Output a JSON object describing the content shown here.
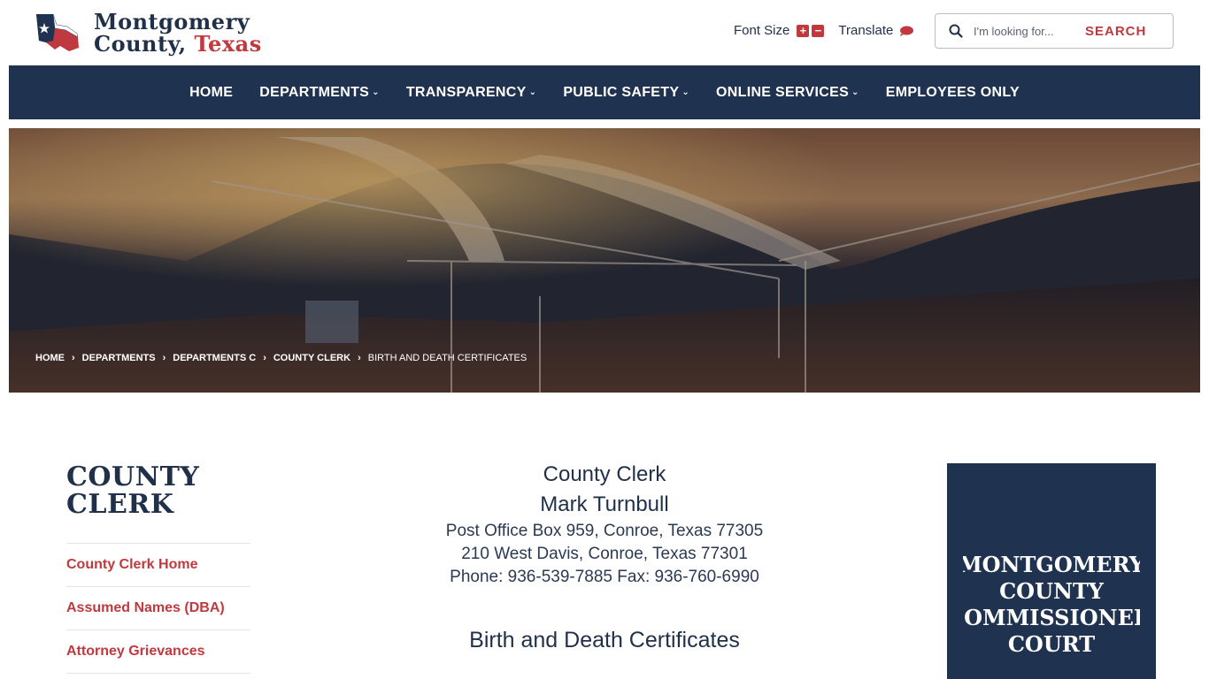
{
  "logo": {
    "line1": "Montgomery",
    "line2_prefix": "County, ",
    "line2_accent": "Texas"
  },
  "utility": {
    "font_size_label": "Font Size",
    "font_plus": "+",
    "font_minus": "−",
    "translate_label": "Translate"
  },
  "search": {
    "placeholder": "I'm looking for...",
    "button_label": "SEARCH"
  },
  "nav": {
    "items": [
      {
        "label": "HOME"
      },
      {
        "label": "DEPARTMENTS"
      },
      {
        "label": "TRANSPARENCY"
      },
      {
        "label": "PUBLIC SAFETY"
      },
      {
        "label": "ONLINE SERVICES"
      },
      {
        "label": "EMPLOYEES ONLY"
      }
    ],
    "chevron": "⌄"
  },
  "breadcrumb": {
    "items": [
      "HOME",
      "DEPARTMENTS",
      "DEPARTMENTS C",
      "COUNTY CLERK",
      "BIRTH AND DEATH CERTIFICATES"
    ],
    "separator": "›"
  },
  "sidebar": {
    "title_line1": "COUNTY",
    "title_line2": "CLERK",
    "links": [
      "County Clerk Home",
      "Assumed Names (DBA)",
      "Attorney Grievances"
    ]
  },
  "main": {
    "office": "County Clerk",
    "name": "Mark Turnbull",
    "address1": "Post Office Box 959, Conroe, Texas 77305",
    "address2": "210 West Davis, Conroe, Texas 77301",
    "phone": "Phone: 936-539-7885 Fax: 936-760-6990",
    "heading": "Birth and Death Certificates"
  },
  "promo": {
    "lines": [
      "MONTGOMERY",
      "COUNTY",
      "COMMISSIONERS",
      "COURT"
    ]
  },
  "colors": {
    "navy": "#1f3350",
    "accent_red": "#c0393e",
    "text_navy": "#1f3048"
  }
}
